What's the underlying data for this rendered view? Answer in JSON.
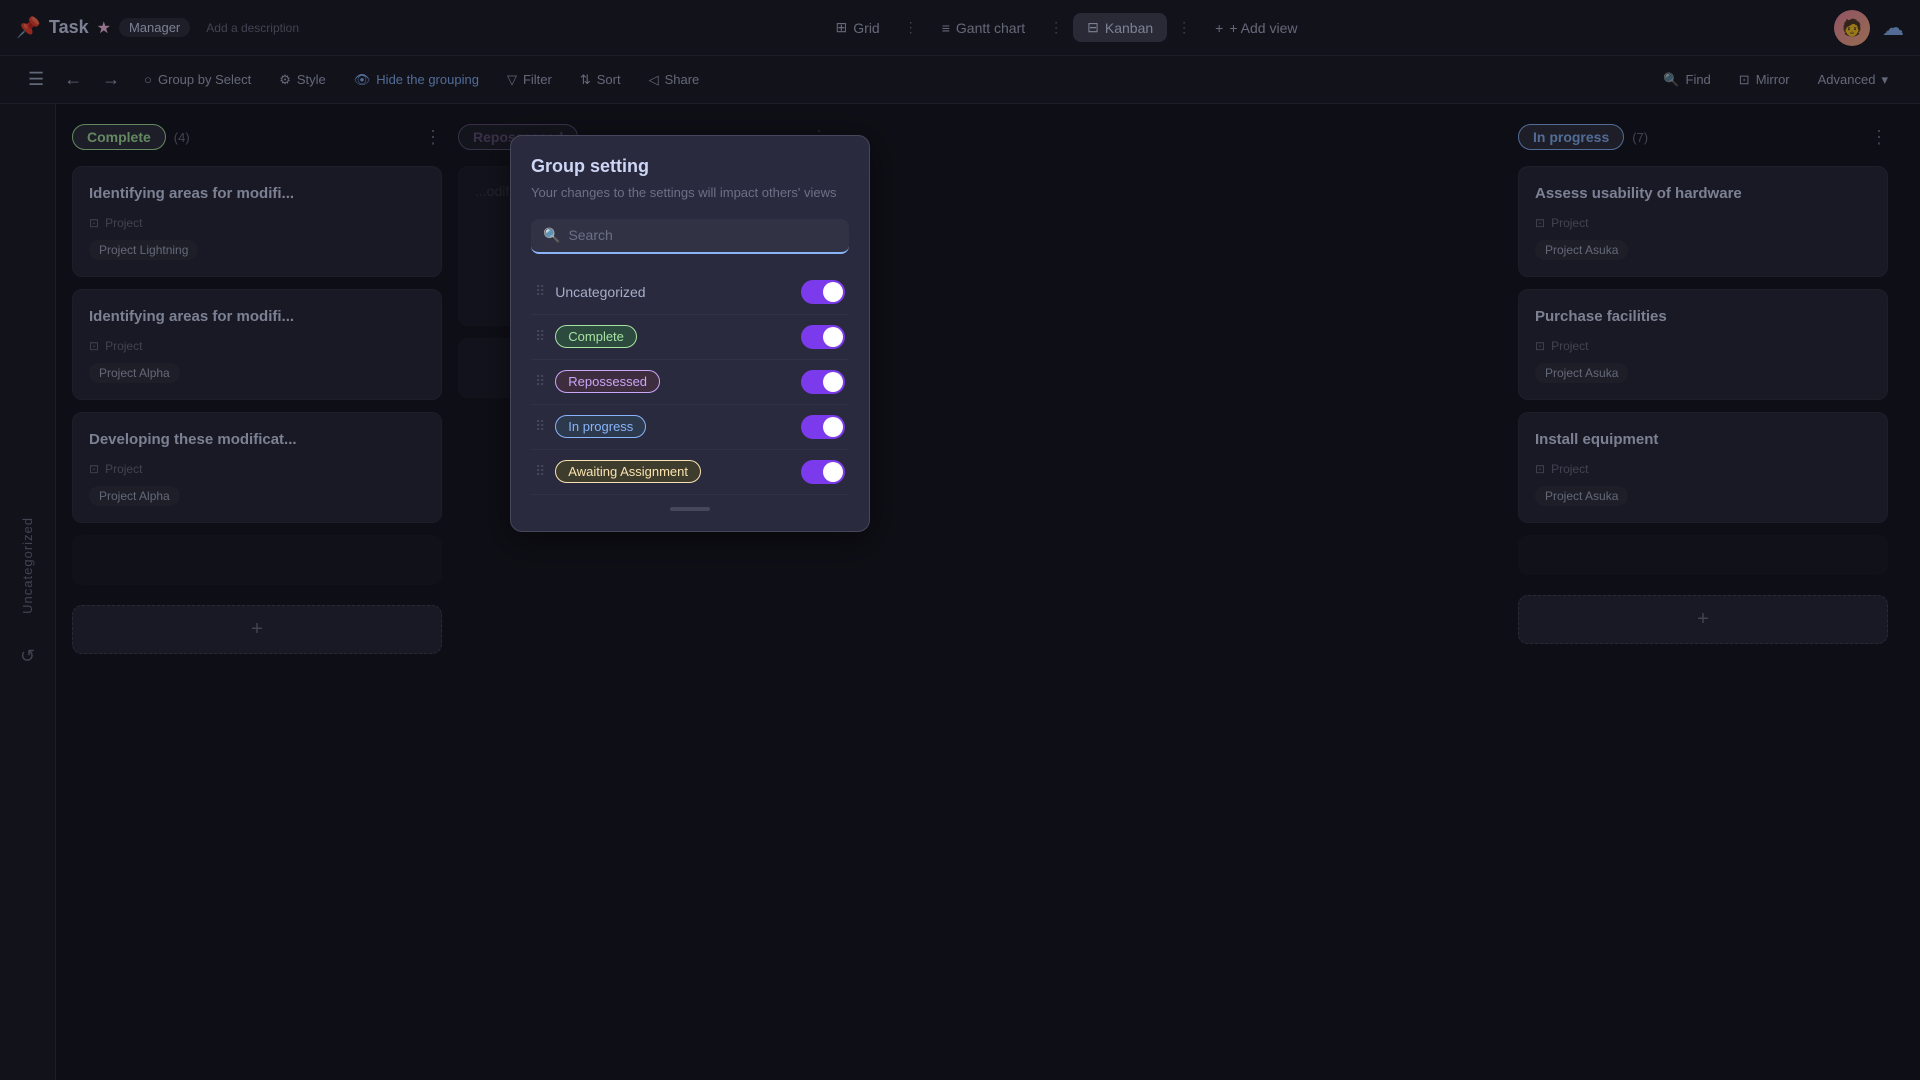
{
  "app": {
    "title": "Task",
    "title_icon": "📌",
    "star_icon": "★",
    "manager_badge": "Manager",
    "subtitle": "Add a description"
  },
  "tabs": [
    {
      "id": "grid",
      "label": "Grid",
      "icon": "⊞",
      "active": false
    },
    {
      "id": "gantt",
      "label": "Gantt chart",
      "icon": "≡",
      "active": false
    },
    {
      "id": "kanban",
      "label": "Kanban",
      "icon": "⊟",
      "active": true
    },
    {
      "id": "add_view",
      "label": "+ Add view",
      "active": false
    }
  ],
  "toolbar": {
    "group_by": "Group by Select",
    "style": "Style",
    "hide_grouping": "Hide the grouping",
    "filter": "Filter",
    "sort": "Sort",
    "share": "Share",
    "find": "Find",
    "mirror": "Mirror",
    "advanced": "Advanced"
  },
  "sidebar": {
    "label": "Uncategorized"
  },
  "columns": [
    {
      "id": "complete",
      "title": "Complete",
      "count": 4,
      "badge_class": "badge-complete",
      "cards": [
        {
          "title": "Identifying areas for modifi...",
          "project_label": "Project",
          "tag": "Project Lightning"
        },
        {
          "title": "Identifying areas for modifi...",
          "project_label": "Project",
          "tag": "Project Alpha"
        },
        {
          "title": "Developing these modificat...",
          "project_label": "Project",
          "tag": "Project Alpha"
        }
      ],
      "add_label": "+"
    },
    {
      "id": "inprogress",
      "title": "In progress",
      "count": 7,
      "badge_class": "badge-inprogress",
      "cards": [
        {
          "title": "Assess usability of hardware",
          "project_label": "Project",
          "tag": "Project Asuka"
        },
        {
          "title": "Purchase facilities",
          "project_label": "Project",
          "tag": "Project Asuka"
        },
        {
          "title": "Install equipment",
          "project_label": "Project",
          "tag": "Project Asuka"
        }
      ],
      "add_label": "+"
    }
  ],
  "group_setting": {
    "title": "Group setting",
    "subtitle": "Your changes to the settings will impact others' views",
    "search_placeholder": "Search",
    "groups": [
      {
        "id": "uncategorized",
        "label": "Uncategorized",
        "type": "plain",
        "enabled": true
      },
      {
        "id": "complete",
        "label": "Complete",
        "type": "complete",
        "enabled": true
      },
      {
        "id": "repossessed",
        "label": "Repossessed",
        "type": "repossessed",
        "enabled": true
      },
      {
        "id": "inprogress",
        "label": "In progress",
        "type": "inprogress",
        "enabled": true
      },
      {
        "id": "awaiting",
        "label": "Awaiting Assignment",
        "type": "awaiting",
        "enabled": true
      }
    ]
  }
}
